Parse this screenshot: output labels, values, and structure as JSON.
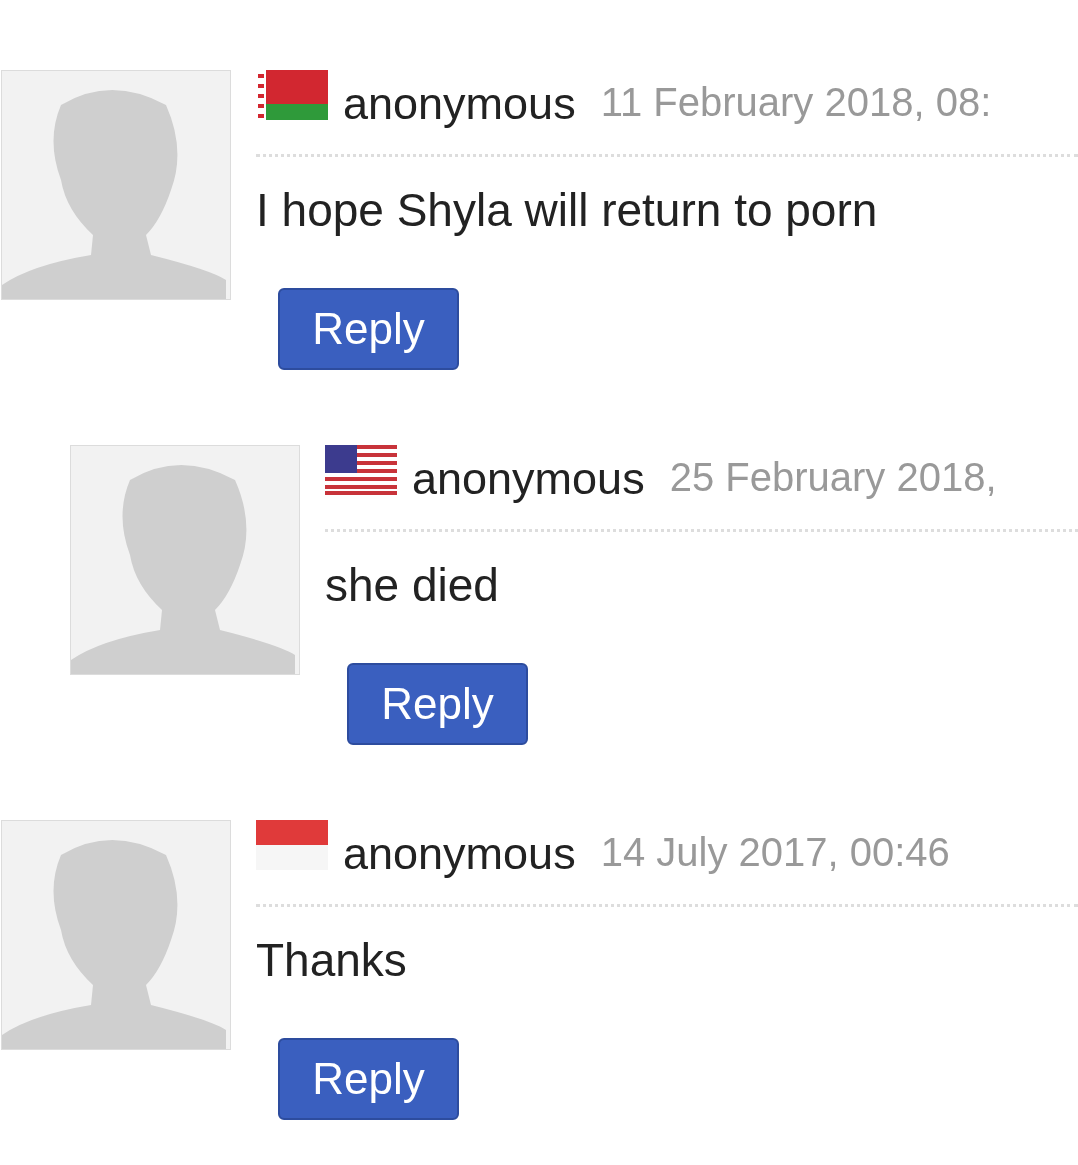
{
  "comments": [
    {
      "kind": "red-green",
      "author": "anonymous",
      "date": "11 February 2018, 08:",
      "text": "I hope Shyla will return to porn",
      "reply": "Reply",
      "children": [
        {
          "kind": "stars-stripes",
          "author": "anonymous",
          "date": "25 February 2018,",
          "text": "she died",
          "reply": "Reply"
        }
      ]
    },
    {
      "kind": "red-white",
      "author": "anonymous",
      "date": "14 July 2017, 00:46",
      "text": "Thanks",
      "reply": "Reply"
    }
  ]
}
